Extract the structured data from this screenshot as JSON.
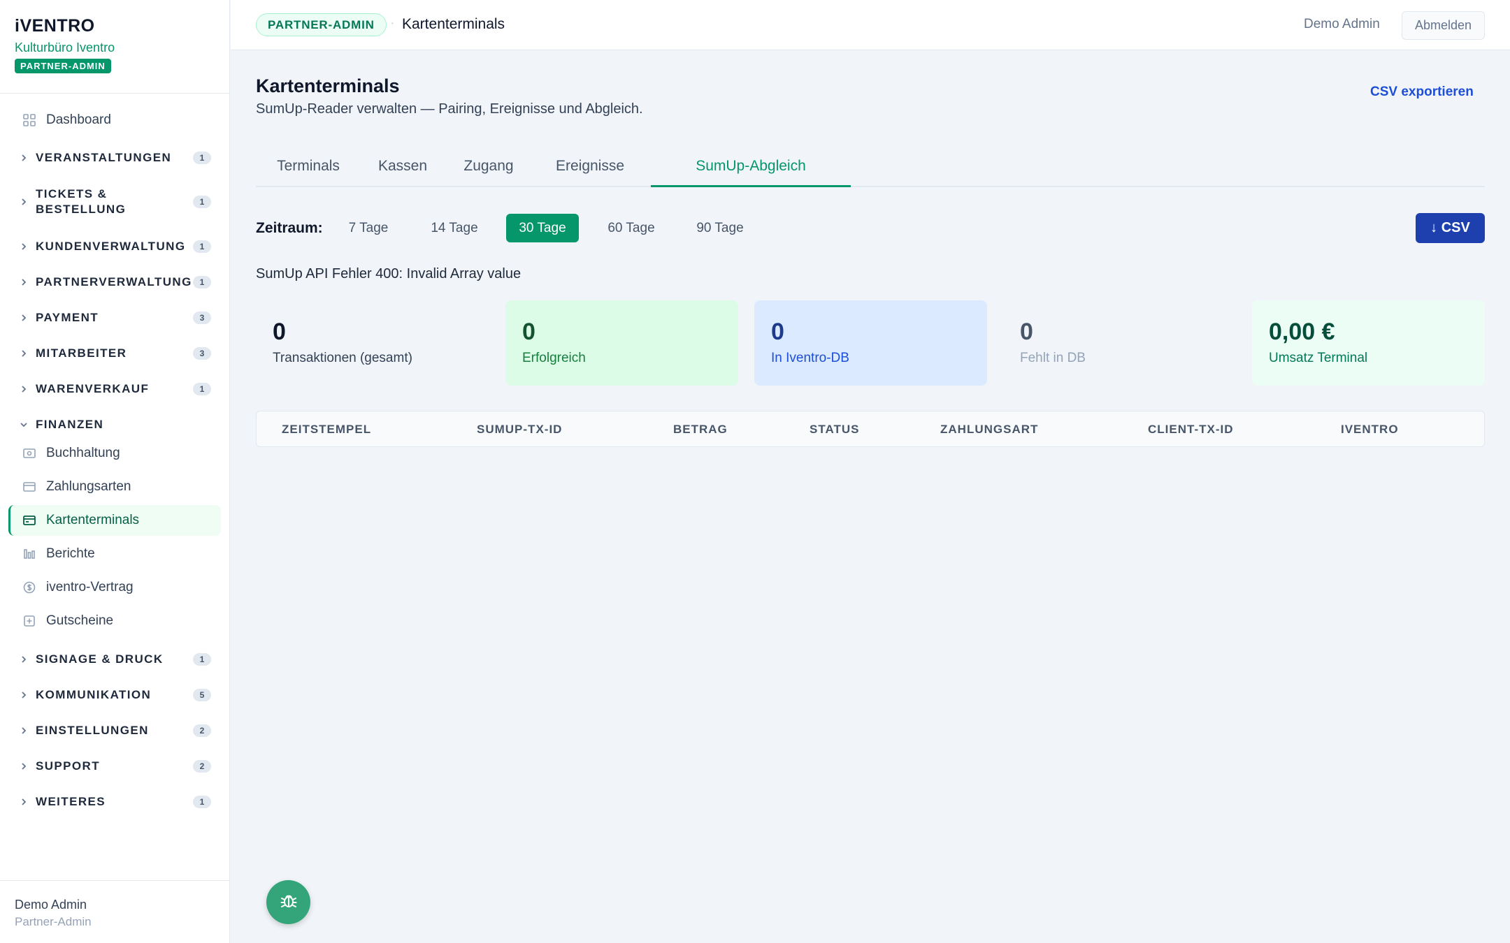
{
  "brand": {
    "logo": "iVENTRO",
    "org": "Kulturbüro Iventro",
    "badge": "PARTNER-ADMIN"
  },
  "sidebar": {
    "dashboard": "Dashboard",
    "groups": [
      {
        "label": "VERANSTALTUNGEN",
        "count": "1"
      },
      {
        "label": "TICKETS & BESTELLUNG",
        "count": "1"
      },
      {
        "label": "KUNDENVERWALTUNG",
        "count": "1"
      },
      {
        "label": "PARTNERVERWALTUNG",
        "count": "1"
      },
      {
        "label": "PAYMENT",
        "count": "3"
      },
      {
        "label": "MITARBEITER",
        "count": "3"
      },
      {
        "label": "WARENVERKAUF",
        "count": "1"
      },
      {
        "label": "FINANZEN"
      },
      {
        "label": "SIGNAGE & DRUCK",
        "count": "1"
      },
      {
        "label": "KOMMUNIKATION",
        "count": "5"
      },
      {
        "label": "EINSTELLUNGEN",
        "count": "2"
      },
      {
        "label": "SUPPORT",
        "count": "2"
      },
      {
        "label": "WEITERES",
        "count": "1"
      }
    ],
    "finanzen_items": [
      {
        "label": "Buchhaltung",
        "icon": "receipt-icon"
      },
      {
        "label": "Zahlungsarten",
        "icon": "card-icon"
      },
      {
        "label": "Kartenterminals",
        "icon": "terminal-icon",
        "active": true
      },
      {
        "label": "Berichte",
        "icon": "chart-icon"
      },
      {
        "label": "iventro-Vertrag",
        "icon": "dollar-icon"
      },
      {
        "label": "Gutscheine",
        "icon": "gift-icon"
      }
    ],
    "footer": {
      "name": "Demo Admin",
      "role": "Partner-Admin"
    }
  },
  "topbar": {
    "badge": "PARTNER-ADMIN",
    "separator": "·",
    "title": "Kartenterminals",
    "user": "Demo Admin",
    "logout": "Abmelden"
  },
  "page": {
    "title": "Kartenterminals",
    "subtitle": "SumUp-Reader verwalten — Pairing, Ereignisse und Abgleich.",
    "csv_export": "CSV exportieren"
  },
  "tabs": [
    "Terminals",
    "Kassen",
    "Zugang",
    "Ereignisse",
    "SumUp-Abgleich"
  ],
  "active_tab": "SumUp-Abgleich",
  "range": {
    "label": "Zeitraum:",
    "options": [
      "7 Tage",
      "14 Tage",
      "30 Tage",
      "60 Tage",
      "90 Tage"
    ],
    "selected": "30 Tage",
    "csv_button": "↓ CSV"
  },
  "error": "SumUp API Fehler 400: Invalid Array value",
  "stats": [
    {
      "value": "0",
      "label": "Transaktionen (gesamt)",
      "bg": "#f1f5f9",
      "valColor": "#0f172a",
      "lblColor": "#334155"
    },
    {
      "value": "0",
      "label": "Erfolgreich",
      "bg": "#dcfce7",
      "valColor": "#14532d",
      "lblColor": "#15803d"
    },
    {
      "value": "0",
      "label": "In Iventro-DB",
      "bg": "#dbeafe",
      "valColor": "#1e3a8a",
      "lblColor": "#1d4ed8"
    },
    {
      "value": "0",
      "label": "Fehlt in DB",
      "bg": "#f1f5f9",
      "valColor": "#475569",
      "lblColor": "#94a3b8"
    },
    {
      "value": "0,00 €",
      "label": "Umsatz Terminal",
      "bg": "#ecfdf5",
      "valColor": "#064e3b",
      "lblColor": "#047857"
    }
  ],
  "table": {
    "columns": [
      "ZEITSTEMPEL",
      "SUMUP-TX-ID",
      "BETRAG",
      "STATUS",
      "ZAHLUNGSART",
      "CLIENT-TX-ID",
      "IVENTRO"
    ],
    "rows": []
  },
  "colors": {
    "accent": "#059669",
    "primary_button": "#1e40af",
    "link": "#1d4ed8"
  }
}
